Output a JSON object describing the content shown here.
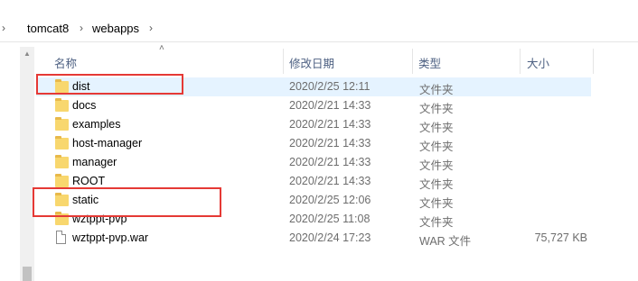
{
  "breadcrumb": {
    "items": [
      "tomcat8",
      "webapps"
    ]
  },
  "columns": {
    "name": "名称",
    "date": "修改日期",
    "type": "类型",
    "size": "大小"
  },
  "files": [
    {
      "name": "dist",
      "date": "2020/2/25 12:11",
      "type": "文件夹",
      "size": "",
      "kind": "folder",
      "selected": true
    },
    {
      "name": "docs",
      "date": "2020/2/21 14:33",
      "type": "文件夹",
      "size": "",
      "kind": "folder"
    },
    {
      "name": "examples",
      "date": "2020/2/21 14:33",
      "type": "文件夹",
      "size": "",
      "kind": "folder"
    },
    {
      "name": "host-manager",
      "date": "2020/2/21 14:33",
      "type": "文件夹",
      "size": "",
      "kind": "folder"
    },
    {
      "name": "manager",
      "date": "2020/2/21 14:33",
      "type": "文件夹",
      "size": "",
      "kind": "folder"
    },
    {
      "name": "ROOT",
      "date": "2020/2/21 14:33",
      "type": "文件夹",
      "size": "",
      "kind": "folder"
    },
    {
      "name": "static",
      "date": "2020/2/25 12:06",
      "type": "文件夹",
      "size": "",
      "kind": "folder"
    },
    {
      "name": "wztppt-pvp",
      "date": "2020/2/25 11:08",
      "type": "文件夹",
      "size": "",
      "kind": "folder"
    },
    {
      "name": "wztppt-pvp.war",
      "date": "2020/2/24 17:23",
      "type": "WAR 文件",
      "size": "75,727 KB",
      "kind": "file"
    }
  ],
  "colors": {
    "selection": "#e5f3ff",
    "highlight": "#e53935",
    "folder": "#f8d76e"
  }
}
